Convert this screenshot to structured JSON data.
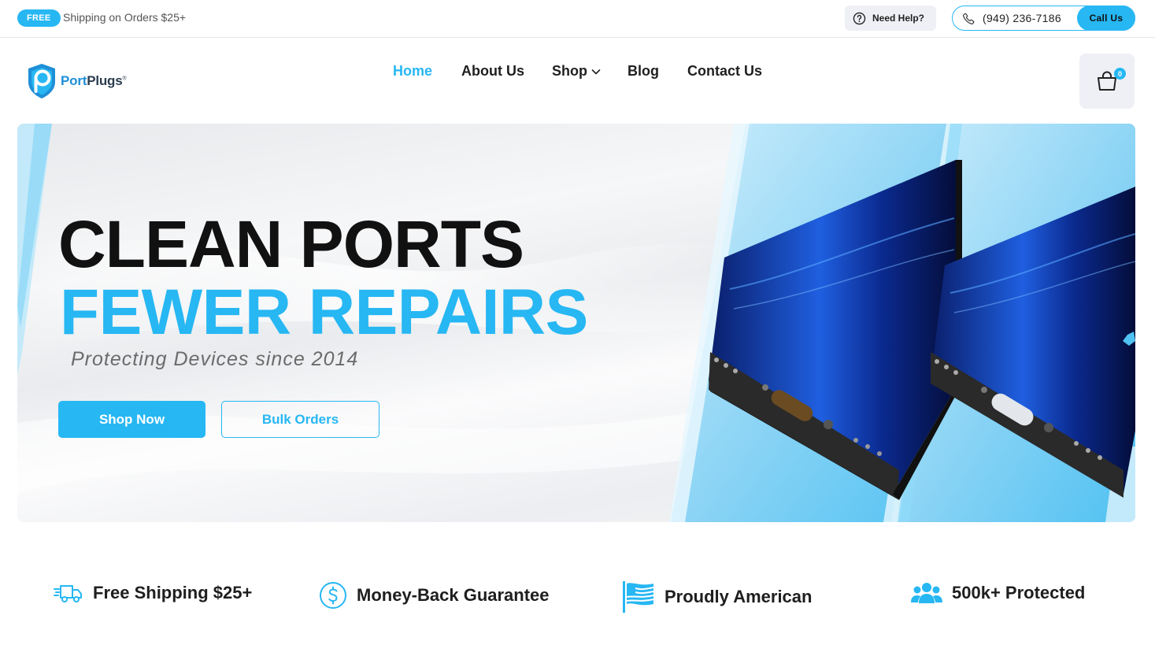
{
  "topbar": {
    "badge": "FREE",
    "shipping_text": "Shipping on Orders $25+",
    "help_label": "Need Help?",
    "phone": "(949) 236-7186",
    "call_label": "Call Us"
  },
  "header": {
    "logo_port": "Port",
    "logo_plugs": "Plugs",
    "logo_reg": "®",
    "nav": [
      {
        "label": "Home",
        "active": true
      },
      {
        "label": "About Us"
      },
      {
        "label": "Shop"
      },
      {
        "label": "Blog"
      },
      {
        "label": "Contact Us"
      }
    ],
    "cart_count": "0"
  },
  "hero": {
    "headline_line1": "CLEAN PORTS",
    "headline_line2": "FEWER REPAIRS",
    "tagline": "Protecting Devices since 2014",
    "shop_button": "Shop Now",
    "bulk_button": "Bulk Orders"
  },
  "features": [
    {
      "icon": "delivery-truck-icon",
      "label": "Free Shipping $25+"
    },
    {
      "icon": "dollar-circle-icon",
      "label": "Money-Back Guarantee"
    },
    {
      "icon": "american-flag-icon",
      "label": "Proudly American"
    },
    {
      "icon": "users-group-icon",
      "label": "500k+ Protected"
    }
  ],
  "colors": {
    "accent": "#27b7f3",
    "dark": "#111111"
  }
}
